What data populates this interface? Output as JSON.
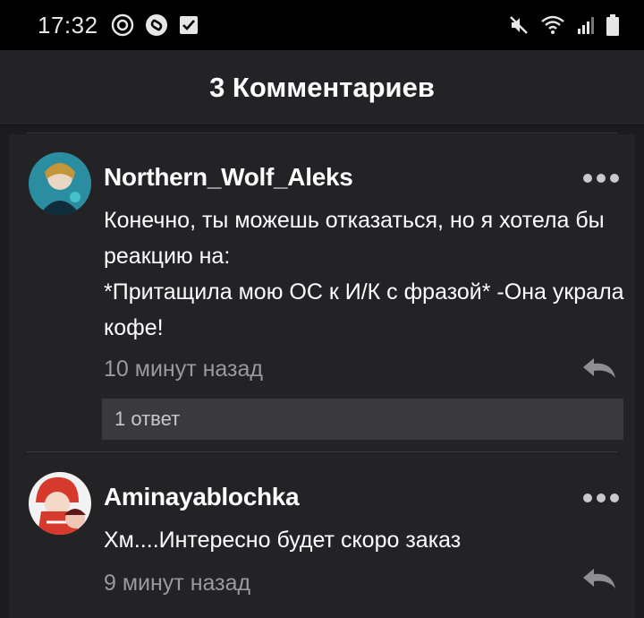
{
  "status_bar": {
    "time": "17:32",
    "left_icons": [
      "target-icon",
      "shazam-icon",
      "checkbox-icon"
    ],
    "right_icons": [
      "mute-icon",
      "wifi-icon",
      "signal-icon",
      "battery-icon"
    ]
  },
  "header": {
    "title": "3 Комментариев"
  },
  "comments": [
    {
      "username": "Northern_Wolf_Aleks",
      "text": "Конечно, ты можешь отказаться, но я хотела бы реакцию на:\n*Притащила мою ОС к И/К с фразой* -Она украла кофе!",
      "time": "10 минут назад",
      "replies": "1 ответ",
      "avatar_color": "#2a8ea0"
    },
    {
      "username": "Aminayablochka",
      "text": "Хм....Интересно будет скоро заказ",
      "time": "9 минут назад",
      "avatar_color": "#d63a2c"
    }
  ],
  "colors": {
    "background": "#232326",
    "status_bar": "#000000",
    "timestamp": "#9a9a9e",
    "reply_bar": "#3a3a3e"
  }
}
